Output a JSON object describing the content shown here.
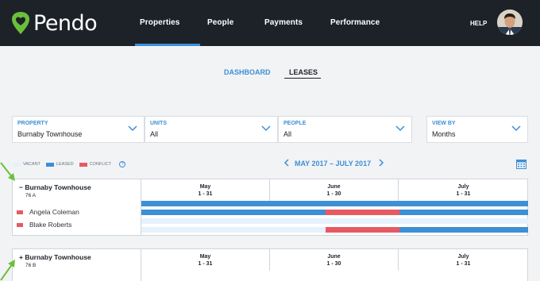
{
  "brand": {
    "name": "Pendo",
    "accent": "#3d8fd6",
    "nav_bg": "#1d2228",
    "logo_green": "#6bbf3a"
  },
  "nav": {
    "items": [
      "Properties",
      "People",
      "Payments",
      "Performance"
    ],
    "active": "Properties",
    "help": "HELP",
    "avatar_icon": "user-avatar"
  },
  "subtabs": {
    "dashboard": "DASHBOARD",
    "leases": "LEASES",
    "active": "LEASES"
  },
  "filters": [
    {
      "label": "PROPERTY",
      "value": "Burnaby Townhouse"
    },
    {
      "label": "UNITS",
      "value": "All"
    },
    {
      "label": "PEOPLE",
      "value": "All"
    },
    {
      "label": "VIEW BY",
      "value": "Months"
    }
  ],
  "legend": {
    "vacant": "VACANT",
    "leased": "LEASED",
    "conflict": "CONFLICT",
    "help": "?",
    "colors": {
      "vacant": "#e6f2fb",
      "leased": "#3d8fd6",
      "conflict": "#e65a63"
    }
  },
  "date_range": "MAY 2017 – JULY 2017",
  "months": [
    {
      "name": "May",
      "days": "1 - 31"
    },
    {
      "name": "June",
      "days": "1 - 30"
    },
    {
      "name": "July",
      "days": "1 - 31"
    }
  ],
  "groups": [
    {
      "toggle": "−",
      "name": "Burnaby Townhouse",
      "unit": "76 A",
      "expanded": true,
      "tenants": [
        "Angela Coleman",
        "Blake Roberts"
      ],
      "rows": [
        {
          "segments": [
            {
              "status": "leased",
              "start": 0,
              "end": 1
            }
          ]
        },
        {
          "segments": [
            {
              "status": "leased",
              "start": 0,
              "end": 0.476
            },
            {
              "status": "conflict",
              "start": 0.476,
              "end": 0.667
            },
            {
              "status": "leased",
              "start": 0.667,
              "end": 1
            }
          ]
        },
        {
          "segments": []
        },
        {
          "segments": [
            {
              "status": "conflict",
              "start": 0.476,
              "end": 0.667
            },
            {
              "status": "leased",
              "start": 0.667,
              "end": 1
            }
          ]
        }
      ]
    },
    {
      "toggle": "+",
      "name": "Burnaby Townhouse",
      "unit": "76 B",
      "expanded": false,
      "tenants": [],
      "rows": []
    }
  ]
}
